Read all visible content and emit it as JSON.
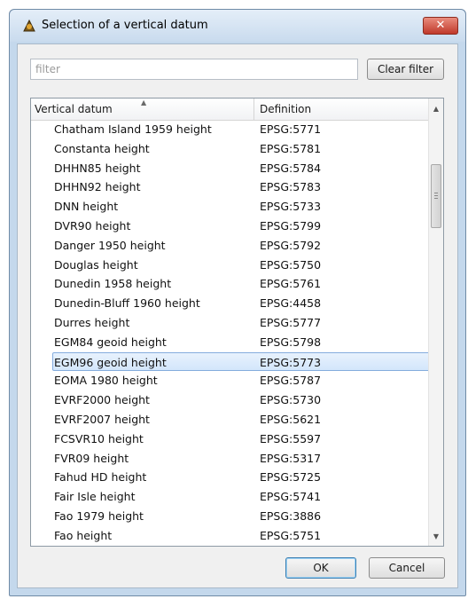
{
  "window": {
    "title": "Selection of a vertical datum",
    "close_label": "✕"
  },
  "filter": {
    "placeholder": "filter",
    "value": "",
    "clear_label": "Clear filter"
  },
  "table": {
    "headers": {
      "datum": "Vertical datum",
      "definition": "Definition"
    },
    "rows": [
      {
        "datum": "Chatham Island 1959 height",
        "definition": "EPSG:5771"
      },
      {
        "datum": "Constanta height",
        "definition": "EPSG:5781"
      },
      {
        "datum": "DHHN85 height",
        "definition": "EPSG:5784"
      },
      {
        "datum": "DHHN92 height",
        "definition": "EPSG:5783"
      },
      {
        "datum": "DNN height",
        "definition": "EPSG:5733"
      },
      {
        "datum": "DVR90 height",
        "definition": "EPSG:5799"
      },
      {
        "datum": "Danger 1950 height",
        "definition": "EPSG:5792"
      },
      {
        "datum": "Douglas height",
        "definition": "EPSG:5750"
      },
      {
        "datum": "Dunedin 1958 height",
        "definition": "EPSG:5761"
      },
      {
        "datum": "Dunedin-Bluff 1960 height",
        "definition": "EPSG:4458"
      },
      {
        "datum": "Durres height",
        "definition": "EPSG:5777"
      },
      {
        "datum": "EGM84 geoid height",
        "definition": "EPSG:5798"
      },
      {
        "datum": "EGM96 geoid height",
        "definition": "EPSG:5773"
      },
      {
        "datum": "EOMA 1980 height",
        "definition": "EPSG:5787"
      },
      {
        "datum": "EVRF2000 height",
        "definition": "EPSG:5730"
      },
      {
        "datum": "EVRF2007 height",
        "definition": "EPSG:5621"
      },
      {
        "datum": "FCSVR10 height",
        "definition": "EPSG:5597"
      },
      {
        "datum": "FVR09 height",
        "definition": "EPSG:5317"
      },
      {
        "datum": "Fahud HD height",
        "definition": "EPSG:5725"
      },
      {
        "datum": "Fair Isle height",
        "definition": "EPSG:5741"
      },
      {
        "datum": "Fao 1979 height",
        "definition": "EPSG:3886"
      },
      {
        "datum": "Fao height",
        "definition": "EPSG:5751"
      }
    ],
    "selected_index": 12
  },
  "buttons": {
    "ok_label": "OK",
    "cancel_label": "Cancel"
  },
  "colors": {
    "selection_fill": "#d3e6fb",
    "selection_border": "#84acdd",
    "close_button": "#c0392b"
  },
  "icons": {
    "title": "datum-app-icon",
    "sort": "sort-up-icon",
    "scroll_up": "scroll-up-arrow-icon",
    "scroll_down": "scroll-down-arrow-icon"
  }
}
